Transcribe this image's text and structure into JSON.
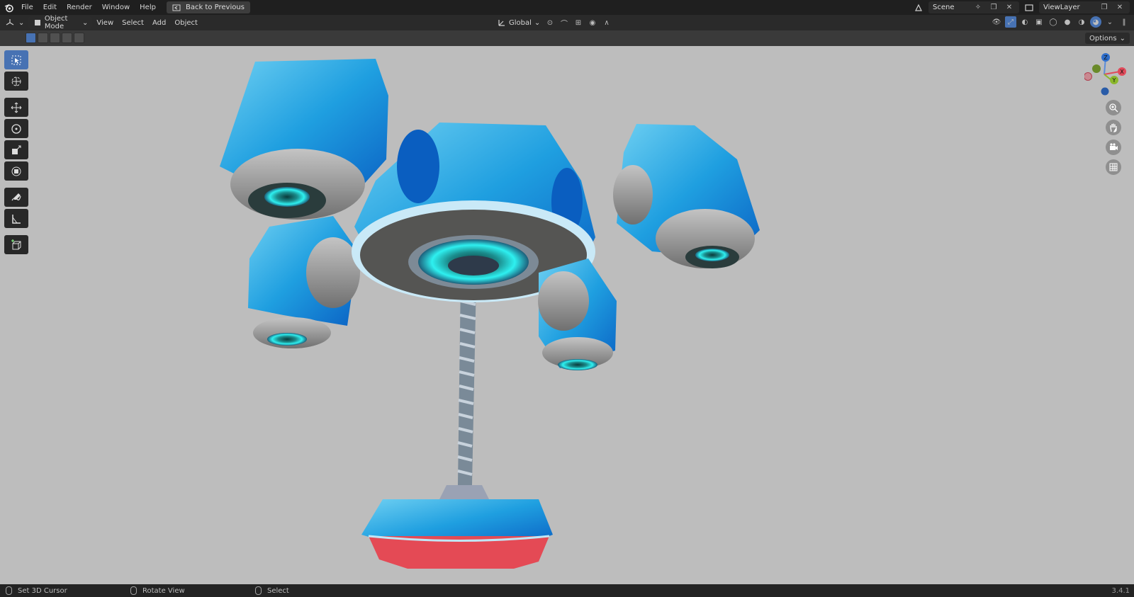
{
  "menubar": {
    "items": [
      "File",
      "Edit",
      "Render",
      "Window",
      "Help"
    ],
    "back_button": "Back to Previous",
    "scene": "Scene",
    "view_layer": "ViewLayer"
  },
  "header": {
    "mode": "Object Mode",
    "menus": [
      "View",
      "Select",
      "Add",
      "Object"
    ],
    "orientation": "Global"
  },
  "tool_header": {
    "options_label": "Options"
  },
  "gizmo": {
    "x_label": "X",
    "y_label": "Y",
    "z_label": "Z"
  },
  "statusbar": {
    "left": "Set 3D Cursor",
    "middle": "Rotate View",
    "right": "Select",
    "version": "3.4.1"
  },
  "colors": {
    "accent": "#4772b3",
    "viewport_bg": "#bdbdbd",
    "model_blue": "#1f9fe0",
    "glow_cyan": "#28e0e0",
    "base_red": "#e44a55"
  }
}
